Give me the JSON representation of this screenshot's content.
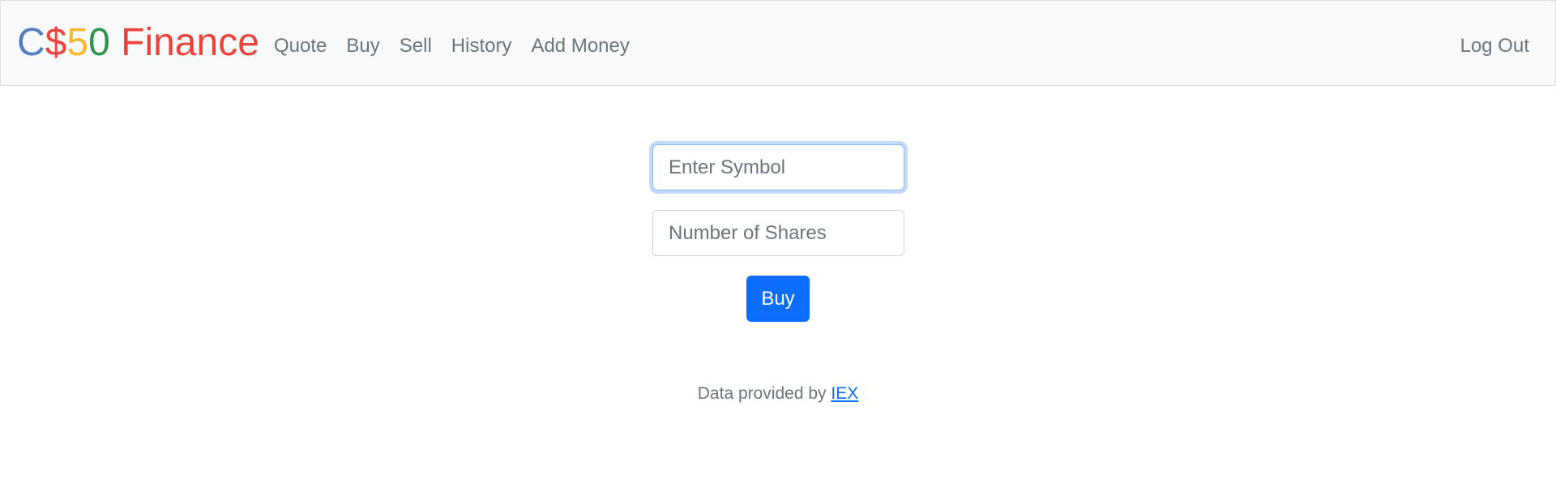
{
  "brand": {
    "parts": [
      {
        "text": "C",
        "color": "#537fbe"
      },
      {
        "text": "$",
        "color": "#ea433b"
      },
      {
        "text": "5",
        "color": "#f5b82e"
      },
      {
        "text": "0",
        "color": "#2e944b"
      },
      {
        "text": " Finance",
        "color": "#ea433b"
      }
    ]
  },
  "nav": {
    "items": [
      {
        "label": "Quote"
      },
      {
        "label": "Buy"
      },
      {
        "label": "Sell"
      },
      {
        "label": "History"
      },
      {
        "label": "Add Money"
      }
    ],
    "logout_label": "Log Out"
  },
  "form": {
    "symbol_placeholder": "Enter Symbol",
    "symbol_value": "",
    "shares_placeholder": "Number of Shares",
    "shares_value": "",
    "submit_label": "Buy"
  },
  "footer": {
    "text": "Data provided by ",
    "link_label": "IEX"
  },
  "colors": {
    "navbar_bg": "#f8f9fa",
    "primary": "#0d6efd",
    "muted": "#6c757d"
  }
}
